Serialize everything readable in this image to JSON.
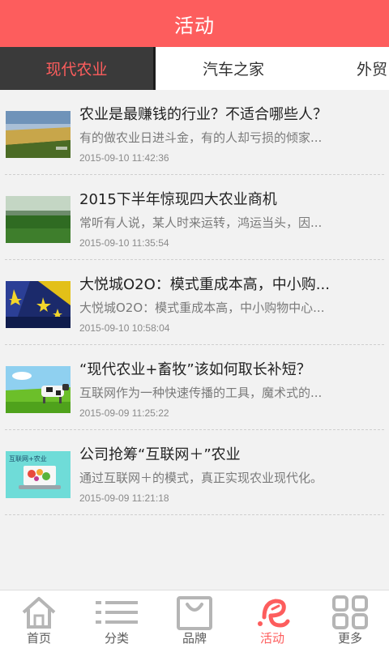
{
  "header": {
    "title": "活动"
  },
  "tabs": [
    {
      "label": "现代农业"
    },
    {
      "label": "汽车之家"
    },
    {
      "label": "外贸"
    }
  ],
  "articles": [
    {
      "title": "农业是最赚钱的行业？不适合哪些人？",
      "summary": "有的做农业日进斗金，有的人却亏损的倾家...",
      "time": "2015-09-10 11:42:36",
      "thumb": "farmland-thumbnail"
    },
    {
      "title": "2015下半年惊现四大农业商机",
      "summary": "常听有人说，某人时来运转，鸿运当头，因...",
      "time": "2015-09-10 11:35:54",
      "thumb": "green-field-thumbnail"
    },
    {
      "title": "大悦城O2O：模式重成本高，中小购...",
      "summary": "大悦城O2O：模式重成本高，中小购物中心...",
      "time": "2015-09-10 10:58:04",
      "thumb": "mall-thumbnail"
    },
    {
      "title": "“现代农业+畜牧”该如何取长补短？",
      "summary": "互联网作为一种快速传播的工具，魔术式的...",
      "time": "2015-09-09 11:25:22",
      "thumb": "cow-thumbnail"
    },
    {
      "title": "公司抢筹“互联网＋”农业",
      "summary": "通过互联网＋的模式，真正实现农业现代化。",
      "time": "2015-09-09 11:21:18",
      "thumb": "internet-agriculture-thumbnail"
    }
  ],
  "thumb_texts": {
    "internet_agriculture": "互联网+农业"
  },
  "tabbar": [
    {
      "label": "首页",
      "icon": "home-icon"
    },
    {
      "label": "分类",
      "icon": "list-icon"
    },
    {
      "label": "品牌",
      "icon": "bag-icon"
    },
    {
      "label": "活动",
      "icon": "activity-icon"
    },
    {
      "label": "更多",
      "icon": "grid-icon"
    }
  ],
  "colors": {
    "accent": "#fd5d5d",
    "tab_active_bg": "#3a3a3a",
    "icon_gray": "#b5b5b5"
  }
}
